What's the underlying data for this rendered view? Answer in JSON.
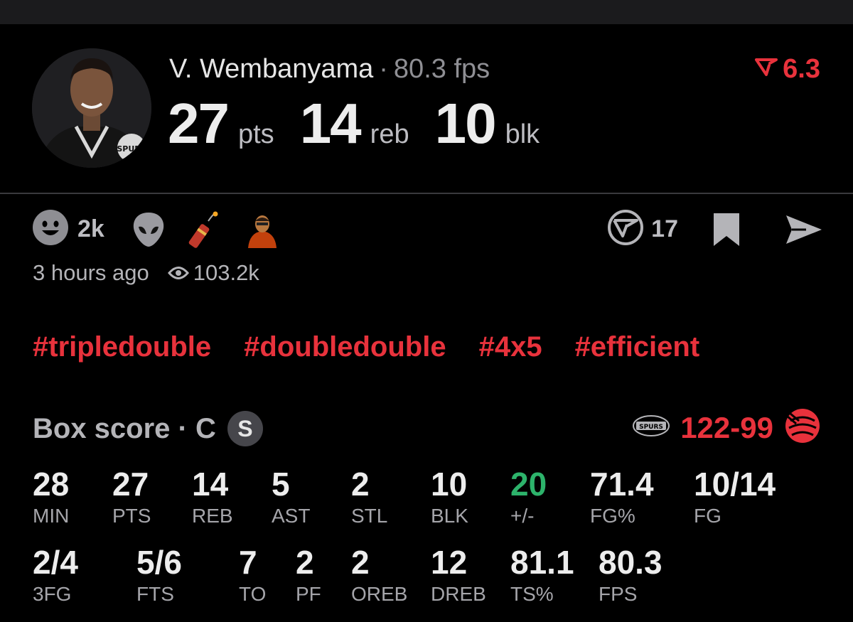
{
  "player": {
    "name": "V. Wembanyama",
    "separator": "·",
    "fps": "80.3 fps",
    "rating": "6.3",
    "headline": [
      {
        "value": "27",
        "unit": "pts"
      },
      {
        "value": "14",
        "unit": "reb"
      },
      {
        "value": "10",
        "unit": "blk"
      }
    ]
  },
  "reactions": {
    "count": "2k",
    "emojis": [
      "grinning-face",
      "alien-face",
      "firecracker",
      "man-dancing"
    ]
  },
  "actions": {
    "comment_count": "17",
    "bookmark": "bookmark-icon",
    "share": "send-icon"
  },
  "meta": {
    "time": "3 hours ago",
    "views": "103.2k"
  },
  "tags": [
    "#tripledouble",
    "#doubledouble",
    "#4x5",
    "#efficient"
  ],
  "box_score": {
    "title": "Box score · C",
    "team_badge": "S",
    "score_home": "122",
    "score_away": "99",
    "row1": [
      {
        "value": "28",
        "label": "MIN"
      },
      {
        "value": "27",
        "label": "PTS"
      },
      {
        "value": "14",
        "label": "REB"
      },
      {
        "value": "5",
        "label": "AST"
      },
      {
        "value": "2",
        "label": "STL"
      },
      {
        "value": "10",
        "label": "BLK"
      },
      {
        "value": "20",
        "label": "+/-"
      },
      {
        "value": "71.4",
        "label": "FG%"
      },
      {
        "value": "10/14",
        "label": "FG"
      }
    ],
    "row2": [
      {
        "value": "2/4",
        "label": "3FG"
      },
      {
        "value": "5/6",
        "label": "FTS"
      },
      {
        "value": "7",
        "label": "TO"
      },
      {
        "value": "2",
        "label": "PF"
      },
      {
        "value": "2",
        "label": "OREB"
      },
      {
        "value": "12",
        "label": "DREB"
      },
      {
        "value": "81.1",
        "label": "TS%"
      },
      {
        "value": "80.3",
        "label": "FPS"
      }
    ]
  },
  "colors": {
    "accent": "#e8323c",
    "positive": "#2db36b",
    "background": "#000000"
  }
}
